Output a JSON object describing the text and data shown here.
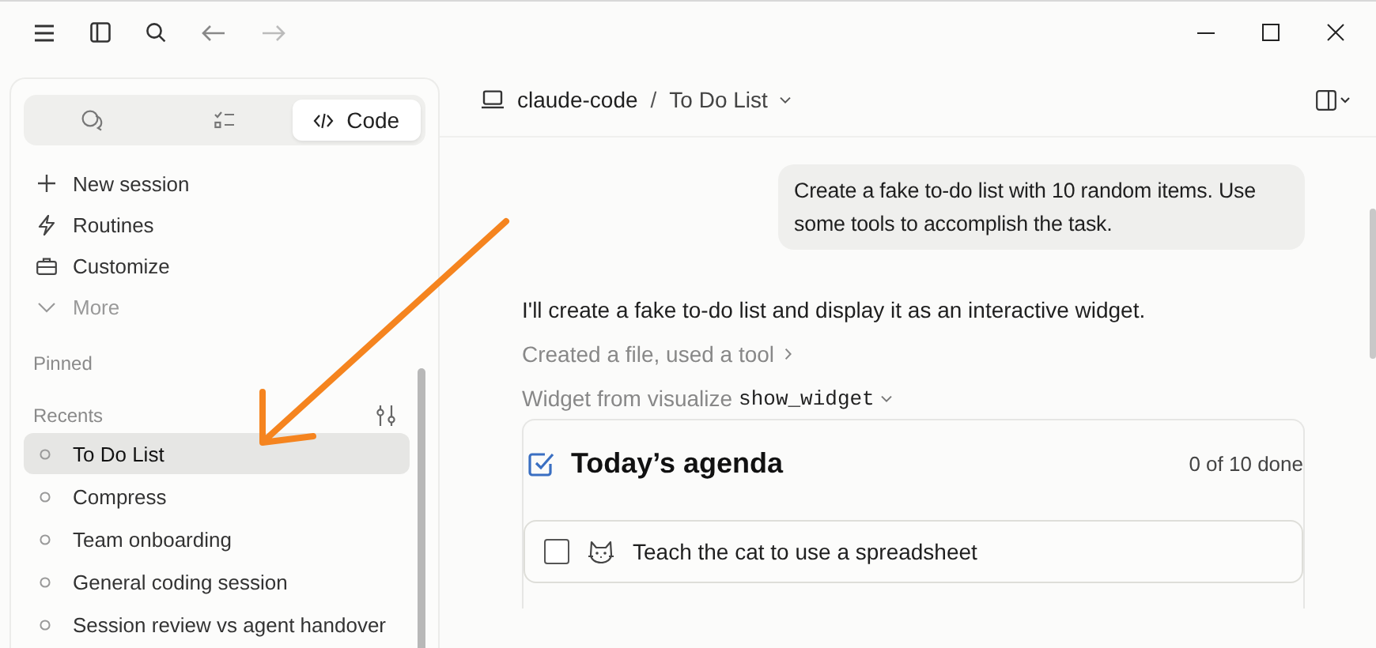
{
  "sidebar": {
    "tabs": [
      {
        "kind": "chat",
        "selected": false
      },
      {
        "kind": "tasks",
        "selected": false
      },
      {
        "kind": "code",
        "label": "Code",
        "selected": true
      }
    ],
    "nav": [
      {
        "kind": "plus",
        "label": "New session",
        "muted": false
      },
      {
        "kind": "bolt",
        "label": "Routines",
        "muted": false
      },
      {
        "kind": "case",
        "label": "Customize",
        "muted": false
      },
      {
        "kind": "chevron",
        "label": "More",
        "muted": true
      }
    ],
    "pinned_heading": "Pinned",
    "recents_heading": "Recents",
    "recents": [
      {
        "label": "To Do List",
        "selected": true
      },
      {
        "label": "Compress",
        "selected": false
      },
      {
        "label": "Team onboarding",
        "selected": false
      },
      {
        "label": "General coding session",
        "selected": false
      },
      {
        "label": "Session review vs agent handover",
        "selected": false
      }
    ]
  },
  "header": {
    "project": "claude-code",
    "separator": "/",
    "session": "To Do List"
  },
  "user_message": "Create a fake to-do list with 10 random items. Use some tools to accomplish the task.",
  "assistant_message": "I'll create a fake to-do list and display it as an interactive widget.",
  "tool_summary": "Created a file, used a tool",
  "widget_source_label": "Widget from visualize",
  "widget_tool": "show_widget",
  "widget": {
    "title": "Today’s agenda",
    "progress": "0 of 10 done",
    "items": [
      {
        "label": "Teach the cat to use a spreadsheet",
        "checked": false
      }
    ]
  }
}
